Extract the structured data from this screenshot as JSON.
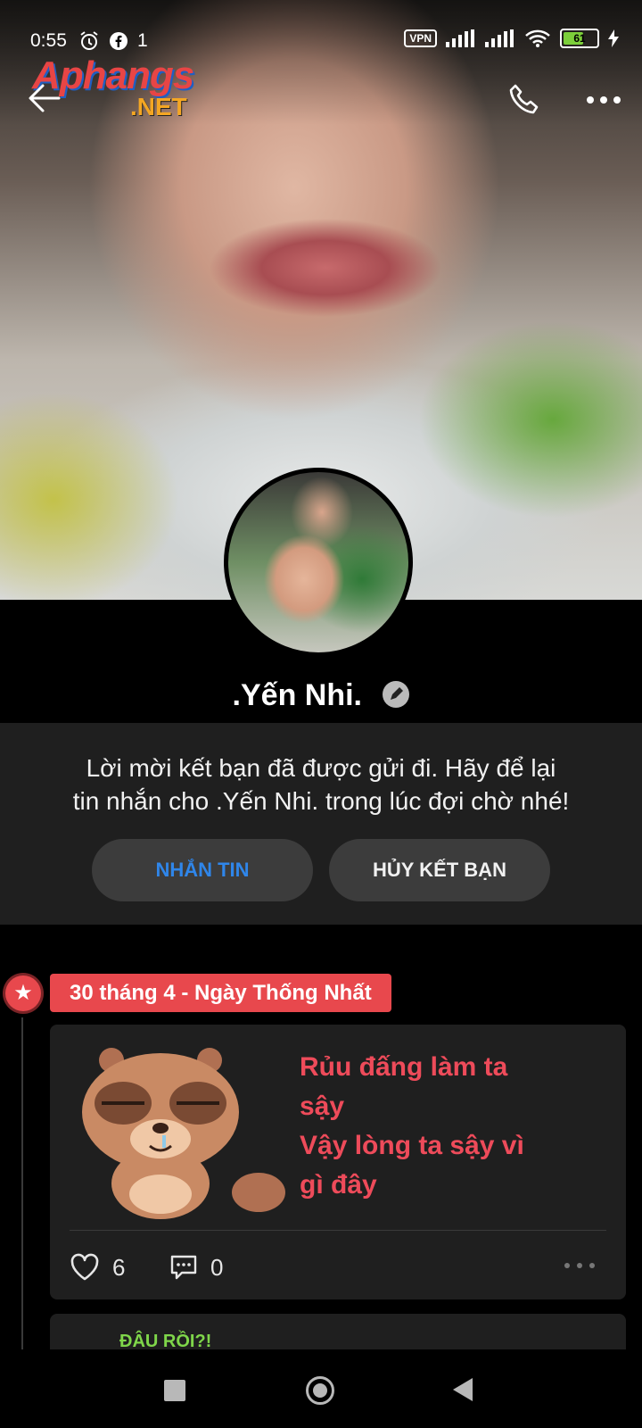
{
  "status_bar": {
    "time": "0:55",
    "notification_count": "1",
    "vpn": "VPN",
    "battery": "61"
  },
  "watermark": {
    "top": "Aphangs",
    "bottom": ".NET"
  },
  "profile": {
    "name": ".Yến Nhi."
  },
  "friend_request": {
    "message_line1": "Lời mời kết bạn đã được gửi đi. Hãy để lại",
    "message_line2": "tin nhắn cho .Yến Nhi. trong lúc đợi chờ nhé!",
    "message_button": "NHẮN TIN",
    "unfriend_button": "HỦY KẾT BẠN"
  },
  "timeline": {
    "event_label": "30 tháng 4 - Ngày Thống Nhất",
    "post": {
      "line1": "Rủu đấng làm ta",
      "line2": "sậy",
      "line3": "Vậy lòng ta sậy vì",
      "line4": "gì đây",
      "likes": "6",
      "comments": "0"
    },
    "next_post_sticker_text": "ĐÂU RỒI?!"
  },
  "colors": {
    "accent_red": "#e8484d",
    "link_blue": "#2f86ea",
    "panel": "#1f1f1f"
  }
}
